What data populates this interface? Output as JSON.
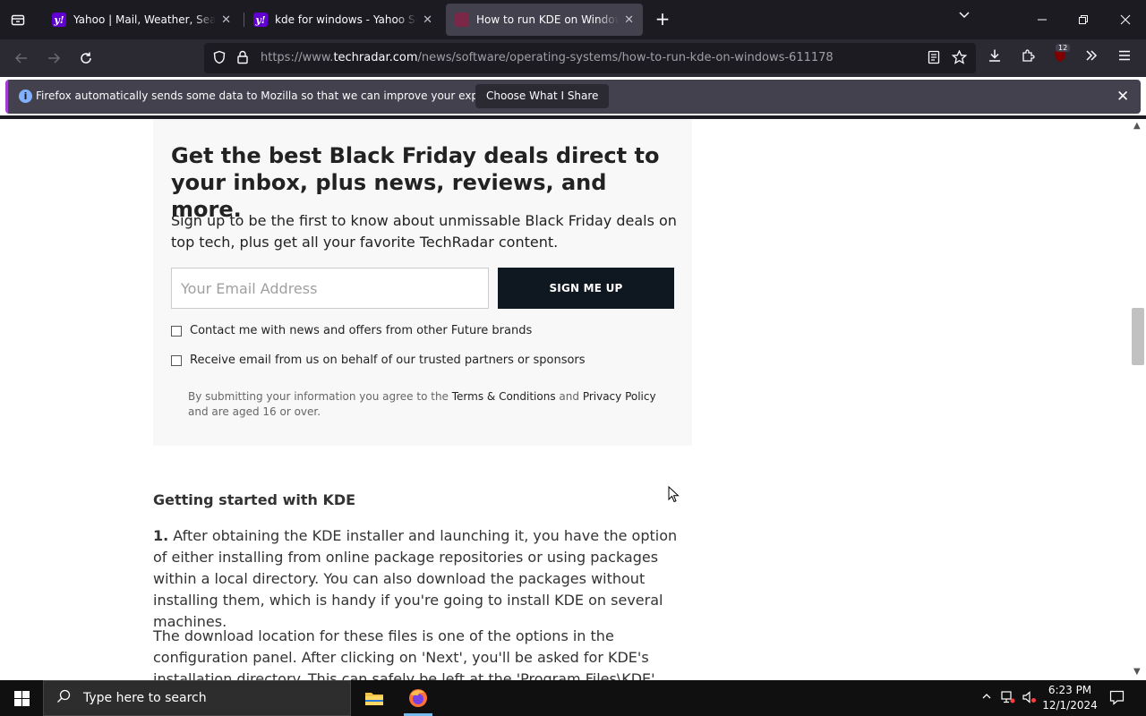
{
  "browser": {
    "tabs": [
      {
        "title": "Yahoo | Mail, Weather, Search, Po",
        "favicon": "y!",
        "active": false
      },
      {
        "title": "kde for windows - Yahoo Search",
        "favicon": "y!",
        "active": false
      },
      {
        "title": "How to run KDE on Windows | Tec",
        "favicon": "",
        "active": true
      }
    ],
    "url_prefix": "https://www.",
    "url_domain": "techradar.com",
    "url_path": "/news/software/operating-systems/how-to-run-kde-on-windows-611178",
    "extension_badge": "12"
  },
  "notification": {
    "text": "Firefox automatically sends some data to Mozilla so that we can improve your experience.",
    "button": "Choose What I Share"
  },
  "newsletter": {
    "title": "Get the best Black Friday deals direct to your inbox, plus news, reviews, and more.",
    "description": "Sign up to be the first to know about unmissable Black Friday deals on top tech, plus get all your favorite TechRadar content.",
    "email_placeholder": "Your Email Address",
    "submit_label": "SIGN ME UP",
    "checkbox_1": "Contact me with news and offers from other Future brands",
    "checkbox_2": "Receive email from us on behalf of our trusted partners or sponsors",
    "legal_1": "By submitting your information you agree to the ",
    "terms_link": "Terms & Conditions",
    "legal_2": " and ",
    "privacy_link": "Privacy Policy",
    "legal_3": " and are aged 16 or over."
  },
  "article": {
    "heading": "Getting started with KDE",
    "step_number": "1.",
    "para_1": " After obtaining the KDE installer and launching it, you have the option of either installing from online package repositories or using packages within a local directory. You can also download the packages without installing them, which is handy if you're going to install KDE on several machines.",
    "para_2": "The download location for these files is one of the options in the configuration panel. After clicking on 'Next', you'll be asked for KDE's installation directory. This can safely be left at the 'Program Files\\KDE' default."
  },
  "taskbar": {
    "search_placeholder": "Type here to search",
    "time": "6:23 PM",
    "date": "12/1/2024"
  },
  "colors": {
    "tabbar_bg": "#1c1b22",
    "active_tab": "#42414d",
    "signup_button": "#0f1720",
    "newsletter_bg": "#f8f8f8"
  }
}
